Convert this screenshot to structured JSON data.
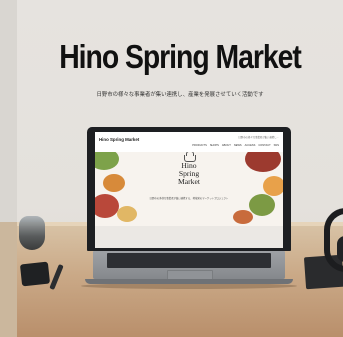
{
  "banner": {
    "headline": "Hino Spring Market",
    "tagline": "日野市の様々な事業者が集い連携し、産業を発展させていく活動です"
  },
  "website": {
    "logo_text": "Hino Spring Market",
    "utility_text": "日野市の様々な事業者が集い連携し…",
    "nav_items": [
      "PRODUCTS",
      "SHOPS",
      "ABOUT",
      "NEWS",
      "ACCESS",
      "CONTACT",
      "SNS"
    ],
    "hero_title_lines": [
      "Hino",
      "Spring",
      "Market"
    ],
    "hero_caption": "日野市の多様な事業者が集い連携する、地域発のマーケットプロジェクト"
  },
  "colors": {
    "wall": "#e4e1dc",
    "table": "#caa987",
    "laptop_body": "#85888c",
    "bezel": "#1d1f22",
    "text": "#111111"
  }
}
